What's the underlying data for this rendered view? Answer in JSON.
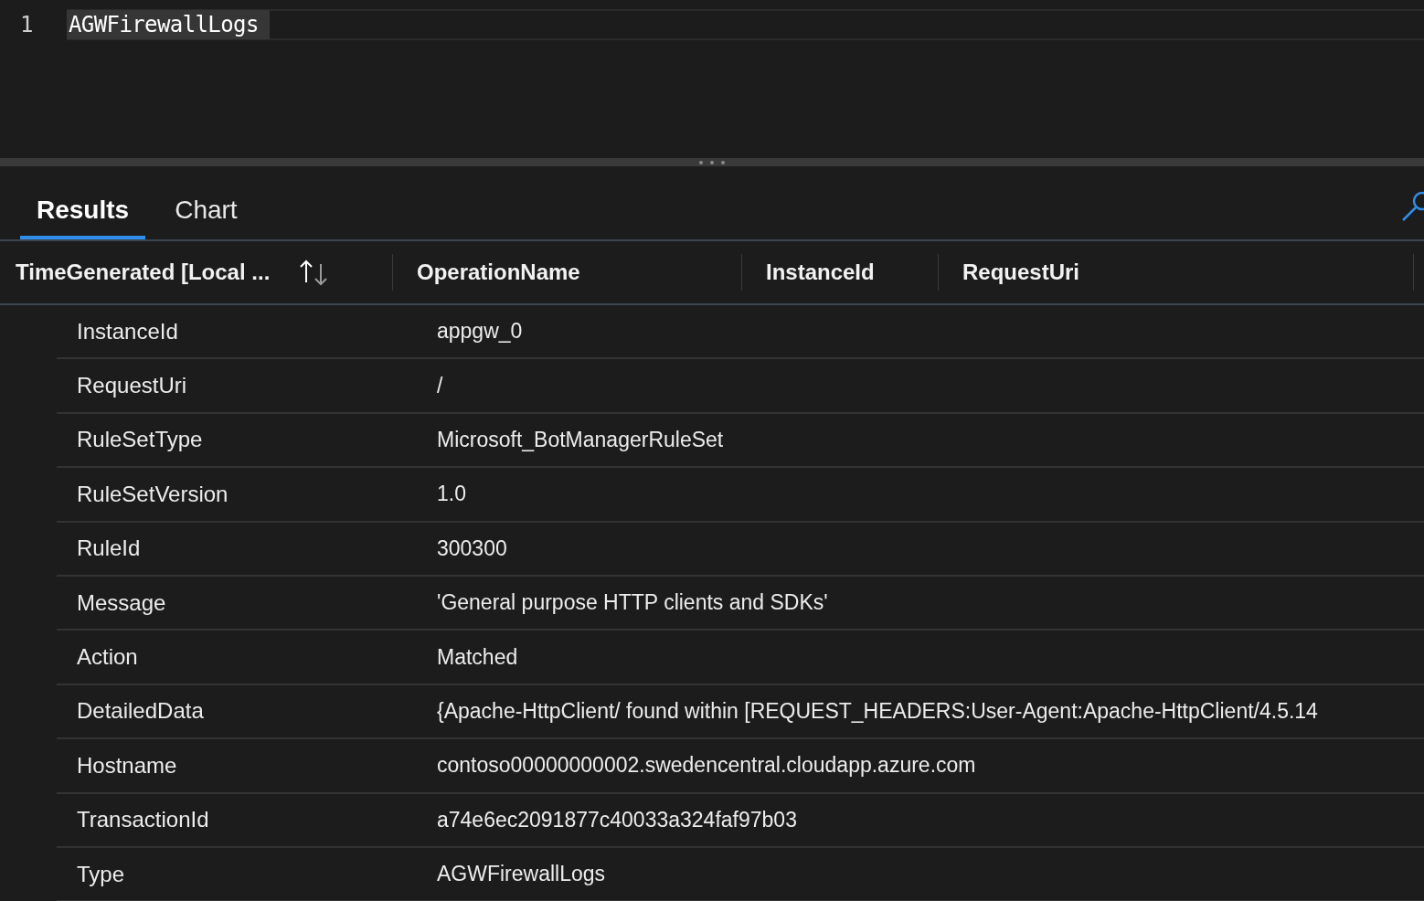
{
  "editor": {
    "lines": [
      {
        "number": "1",
        "text": "AGWFirewallLogs"
      }
    ]
  },
  "tabs": [
    {
      "label": "Results",
      "selected": true
    },
    {
      "label": "Chart",
      "selected": false
    }
  ],
  "table": {
    "columns": [
      {
        "label": "TimeGenerated [Local ...",
        "sortable": true
      },
      {
        "label": "OperationName",
        "sortable": false
      },
      {
        "label": "InstanceId",
        "sortable": false
      },
      {
        "label": "RequestUri",
        "sortable": false
      }
    ],
    "details": [
      {
        "field": "InstanceId",
        "value": "appgw_0"
      },
      {
        "field": "RequestUri",
        "value": "/"
      },
      {
        "field": "RuleSetType",
        "value": "Microsoft_BotManagerRuleSet"
      },
      {
        "field": "RuleSetVersion",
        "value": "1.0"
      },
      {
        "field": "RuleId",
        "value": "300300"
      },
      {
        "field": "Message",
        "value": "'General purpose HTTP clients and SDKs'"
      },
      {
        "field": "Action",
        "value": "Matched"
      },
      {
        "field": "DetailedData",
        "value": "{Apache-HttpClient/ found within [REQUEST_HEADERS:User-Agent:Apache-HttpClient/4.5.14"
      },
      {
        "field": "Hostname",
        "value": "contoso00000000002.swedencentral.cloudapp.azure.com"
      },
      {
        "field": "TransactionId",
        "value": "a74e6ec2091877c40033a324faf97b03"
      },
      {
        "field": "Type",
        "value": "AGWFirewallLogs"
      }
    ]
  }
}
